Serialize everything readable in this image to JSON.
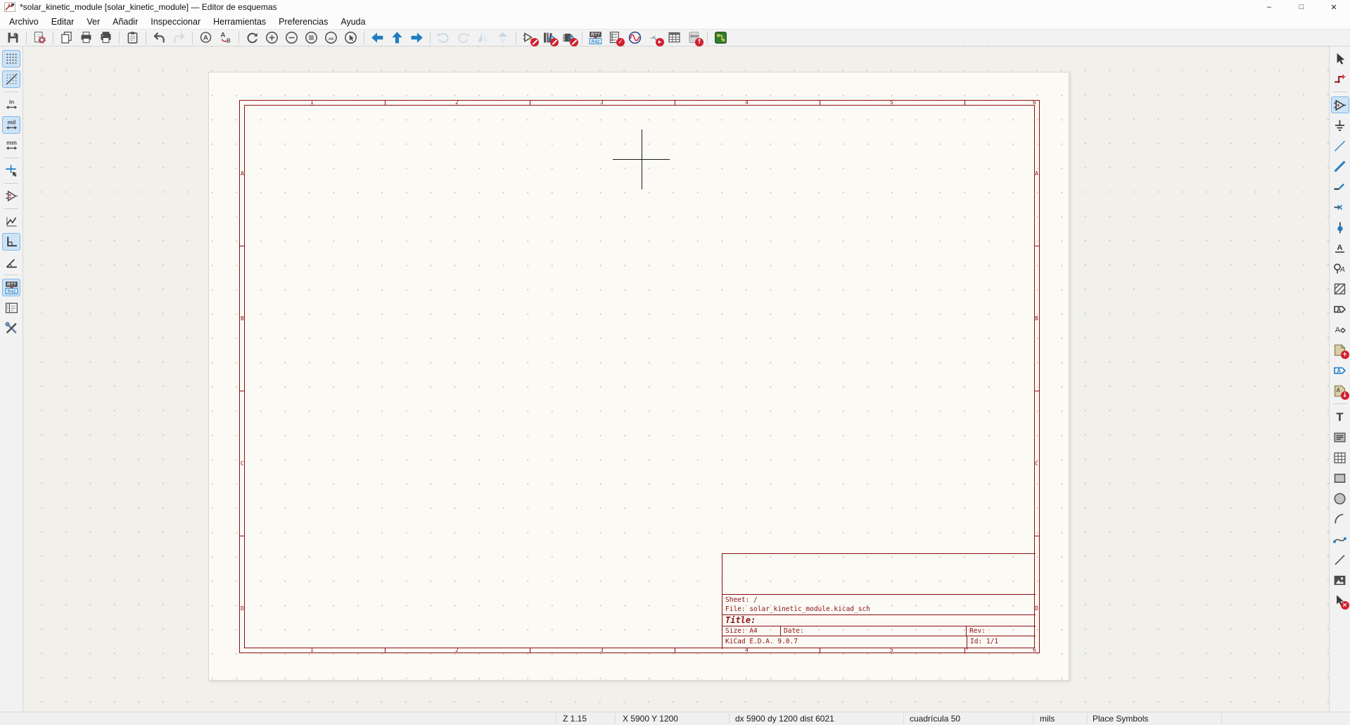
{
  "window": {
    "title": "*solar_kinetic_module [solar_kinetic_module] — Editor de esquemas",
    "minimize_glyph": "–",
    "maximize_glyph": "□",
    "close_glyph": "✕"
  },
  "menubar": {
    "items": [
      {
        "id": "archivo",
        "label": "Archivo"
      },
      {
        "id": "editar",
        "label": "Editar"
      },
      {
        "id": "ver",
        "label": "Ver"
      },
      {
        "id": "anadir",
        "label": "Añadir"
      },
      {
        "id": "inspeccionar",
        "label": "Inspeccionar"
      },
      {
        "id": "herramientas",
        "label": "Herramientas"
      },
      {
        "id": "preferencias",
        "label": "Preferencias"
      },
      {
        "id": "ayuda",
        "label": "Ayuda"
      }
    ]
  },
  "toolbar_top": {
    "items": [
      {
        "name": "save-button",
        "icon": "floppy"
      },
      {
        "sep": true
      },
      {
        "name": "schematic-setup-button",
        "icon": "setup"
      },
      {
        "sep": true
      },
      {
        "name": "page-settings-button",
        "icon": "pages"
      },
      {
        "name": "print-button",
        "icon": "print"
      },
      {
        "name": "plot-button",
        "icon": "plot"
      },
      {
        "sep": true
      },
      {
        "name": "paste-button",
        "icon": "paste"
      },
      {
        "sep": true
      },
      {
        "name": "undo-button",
        "icon": "undo"
      },
      {
        "name": "redo-button",
        "icon": "redo",
        "disabled": true
      },
      {
        "sep": true
      },
      {
        "name": "find-button",
        "icon": "find"
      },
      {
        "name": "find-replace-button",
        "icon": "findreplace"
      },
      {
        "sep": true
      },
      {
        "name": "refresh-button",
        "icon": "refresh"
      },
      {
        "name": "zoom-in-button",
        "icon": "zoomin"
      },
      {
        "name": "zoom-out-button",
        "icon": "zoomout"
      },
      {
        "name": "zoom-fit-button",
        "icon": "zoomfit"
      },
      {
        "name": "zoom-objects-button",
        "icon": "zoomobjects"
      },
      {
        "name": "zoom-selection-button",
        "icon": "zoomselection"
      },
      {
        "sep": true
      },
      {
        "name": "nav-back-button",
        "icon": "navleft"
      },
      {
        "name": "nav-up-button",
        "icon": "navup"
      },
      {
        "name": "nav-forward-button",
        "icon": "navright"
      },
      {
        "sep": true
      },
      {
        "name": "rotate-ccw-button",
        "icon": "rotccw",
        "disabled": true
      },
      {
        "name": "rotate-cw-button",
        "icon": "rotcw",
        "disabled": true
      },
      {
        "name": "mirror-v-button",
        "icon": "mirrorv",
        "disabled": true
      },
      {
        "name": "mirror-h-button",
        "icon": "mirrorh",
        "disabled": true
      },
      {
        "sep": true
      },
      {
        "name": "symbol-editor-button",
        "icon": "symedit",
        "overlay": "no"
      },
      {
        "name": "library-browser-button",
        "icon": "libbrowse",
        "overlay": "no"
      },
      {
        "name": "footprint-assign-button",
        "icon": "fpassign",
        "overlay": "no"
      },
      {
        "sep": true
      },
      {
        "name": "annotate-button",
        "icon": "annotate"
      },
      {
        "name": "erc-button",
        "icon": "erc",
        "overlay": "check"
      },
      {
        "name": "simulator-button",
        "icon": "simulator"
      },
      {
        "name": "sim-probe-button",
        "icon": "simprobe",
        "overlay": "run"
      },
      {
        "name": "symbol-fields-table-button",
        "icon": "fieldstable"
      },
      {
        "name": "export-bom-button",
        "icon": "bom",
        "overlay": "up"
      },
      {
        "sep": true
      },
      {
        "name": "open-pcb-editor-button",
        "icon": "pcbeditor"
      }
    ]
  },
  "toolbar_left": {
    "items": [
      {
        "name": "grid-toggle-button",
        "icon": "grid",
        "active": true
      },
      {
        "name": "grid-overrides-button",
        "icon": "gridslash",
        "active": true
      },
      {
        "sep": true
      },
      {
        "name": "units-inches-button",
        "icon": "unitin"
      },
      {
        "name": "units-mils-button",
        "icon": "unitmil",
        "active": true
      },
      {
        "name": "units-mm-button",
        "icon": "unitmm"
      },
      {
        "sep": true
      },
      {
        "name": "cursor-shape-button",
        "icon": "cursorfull"
      },
      {
        "sep": true
      },
      {
        "name": "hidden-pins-button",
        "icon": "hiddenpins"
      },
      {
        "sep": true
      },
      {
        "name": "wires-any-angle-button",
        "icon": "freeangle"
      },
      {
        "name": "wires-hv-button",
        "icon": "hvlines",
        "active": true
      },
      {
        "name": "wires-45-button",
        "icon": "lines45"
      },
      {
        "sep": true
      },
      {
        "name": "annotate-auto-button",
        "icon": "annotate",
        "active": true
      },
      {
        "name": "hierarchy-navigator-button",
        "icon": "hiernav"
      },
      {
        "name": "properties-panel-button",
        "icon": "toolspanel"
      }
    ]
  },
  "toolbar_right": {
    "items": [
      {
        "name": "select-tool",
        "icon": "select"
      },
      {
        "name": "highlight-net-tool",
        "icon": "highlightnet"
      },
      {
        "sep": true
      },
      {
        "name": "place-symbol-tool",
        "icon": "placesymbol",
        "active": true
      },
      {
        "name": "place-power-tool",
        "icon": "power"
      },
      {
        "name": "draw-wire-tool",
        "icon": "wire"
      },
      {
        "name": "draw-bus-tool",
        "icon": "bus"
      },
      {
        "name": "bus-entry-tool",
        "icon": "busentry"
      },
      {
        "name": "no-connect-tool",
        "icon": "noconnect"
      },
      {
        "name": "junction-tool",
        "icon": "junction"
      },
      {
        "name": "net-label-tool",
        "icon": "netlabel"
      },
      {
        "name": "global-label-tool",
        "icon": "globallabel"
      },
      {
        "name": "rule-area-tool",
        "icon": "rulearea"
      },
      {
        "name": "hierarchical-label-tool",
        "icon": "hierlabel"
      },
      {
        "name": "netclass-directive-tool",
        "icon": "directive"
      },
      {
        "name": "hierarchical-sheet-tool",
        "icon": "hiersheet",
        "overlay": "plus"
      },
      {
        "name": "sheet-pin-tool",
        "icon": "sheetpin"
      },
      {
        "name": "import-sheet-pin-tool",
        "icon": "importpin",
        "overlay": "down"
      },
      {
        "sep": true
      },
      {
        "name": "text-tool",
        "icon": "text"
      },
      {
        "name": "textbox-tool",
        "icon": "textbox"
      },
      {
        "name": "table-tool",
        "icon": "tablegrid"
      },
      {
        "name": "rectangle-tool",
        "icon": "rectangle"
      },
      {
        "name": "circle-tool",
        "icon": "circle"
      },
      {
        "name": "arc-tool",
        "icon": "arc"
      },
      {
        "name": "bezier-tool",
        "icon": "bezier"
      },
      {
        "name": "line-tool",
        "icon": "line"
      },
      {
        "name": "image-tool",
        "icon": "image"
      },
      {
        "name": "delete-tool",
        "icon": "delete",
        "overlay": "x"
      }
    ]
  },
  "sheet": {
    "column_labels": [
      "1",
      "2",
      "3",
      "4",
      "5",
      "6"
    ],
    "row_labels": [
      "A",
      "B",
      "C",
      "D"
    ],
    "titleblock": {
      "sheet": "Sheet: /",
      "file": "File: solar_kinetic_module.kicad_sch",
      "title": "Title:",
      "size": "Size: A4",
      "date": "Date:",
      "rev": "Rev:",
      "company": "KiCad E.D.A. 9.0.7",
      "id": "Id: 1/1"
    }
  },
  "statusbar": {
    "cells": [
      {
        "name": "zoom-level",
        "text": "Z 1.15"
      },
      {
        "name": "cursor-position",
        "text": "X 5900  Y 1200"
      },
      {
        "name": "relative-delta",
        "text": "dx 5900  dy 1200  dist 6021"
      },
      {
        "name": "grid-setting",
        "text": "cuadrícula 50"
      },
      {
        "name": "units",
        "text": "mils"
      },
      {
        "name": "active-tool",
        "text": "Place Symbols"
      }
    ]
  },
  "colors": {
    "frame_red": "#8a1010",
    "accent_blue": "#1f7dc2",
    "danger_red": "#cf2030",
    "pcb_green": "#2f7d32",
    "active_tool_bg": "#cde3f6"
  }
}
